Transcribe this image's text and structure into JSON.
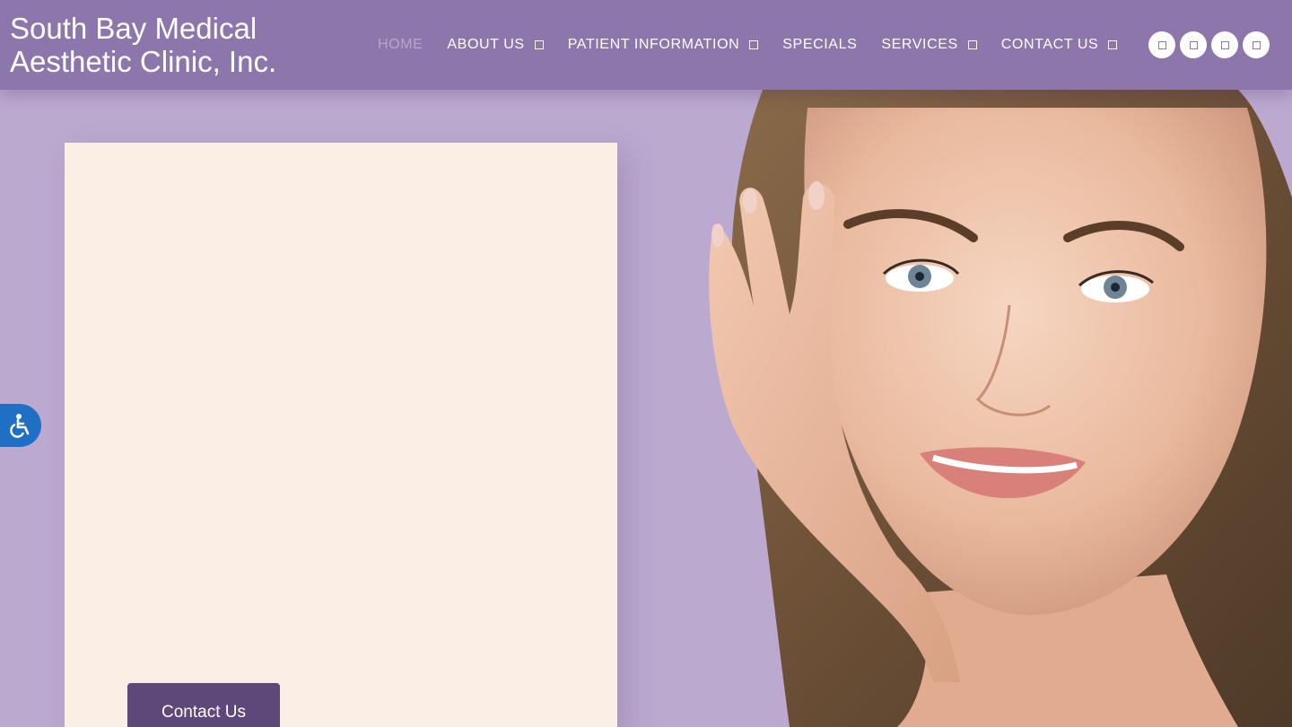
{
  "site": {
    "title_line1": "South Bay Medical",
    "title_line2": "Aesthetic Clinic, Inc."
  },
  "nav": {
    "home": "HOME",
    "about": "ABOUT US",
    "patient_info": "PATIENT INFORMATION",
    "specials": "SPECIALS",
    "services": "SERVICES",
    "contact": "CONTACT US"
  },
  "social_icons": [
    "social-icon-1",
    "social-icon-2",
    "social-icon-3",
    "social-icon-4"
  ],
  "hero": {
    "cta_label": "Contact Us"
  },
  "accessibility": {
    "icon": "wheelchair-icon"
  },
  "colors": {
    "header": "#8c76ab",
    "background": "#bba9d0",
    "panel": "#fbeee4",
    "button": "#5e4879",
    "accessibility": "#1f6fc5"
  }
}
